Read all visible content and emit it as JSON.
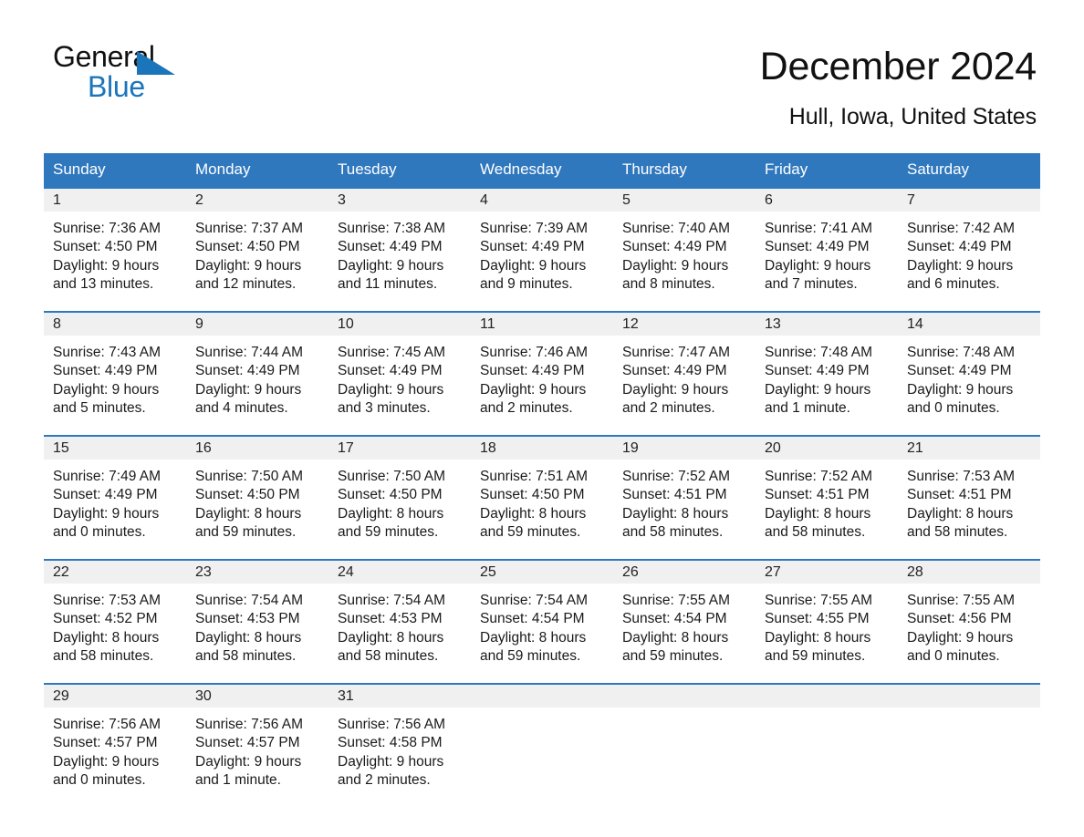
{
  "brand": {
    "name_part1": "General",
    "name_part2": "Blue",
    "accent_color": "#1b75bb"
  },
  "header": {
    "title": "December 2024",
    "location": "Hull, Iowa, United States"
  },
  "calendar": {
    "header_color": "#3078be",
    "daynum_band_color": "#f0f0f0",
    "weekday_headers": [
      "Sunday",
      "Monday",
      "Tuesday",
      "Wednesday",
      "Thursday",
      "Friday",
      "Saturday"
    ],
    "labels": {
      "sunrise_prefix": "Sunrise:",
      "sunset_prefix": "Sunset:",
      "daylight_prefix": "Daylight:"
    },
    "weeks": [
      [
        {
          "day": "1",
          "sunrise": "Sunrise: 7:36 AM",
          "sunset": "Sunset: 4:50 PM",
          "daylight_line1": "Daylight: 9 hours",
          "daylight_line2": "and 13 minutes."
        },
        {
          "day": "2",
          "sunrise": "Sunrise: 7:37 AM",
          "sunset": "Sunset: 4:50 PM",
          "daylight_line1": "Daylight: 9 hours",
          "daylight_line2": "and 12 minutes."
        },
        {
          "day": "3",
          "sunrise": "Sunrise: 7:38 AM",
          "sunset": "Sunset: 4:49 PM",
          "daylight_line1": "Daylight: 9 hours",
          "daylight_line2": "and 11 minutes."
        },
        {
          "day": "4",
          "sunrise": "Sunrise: 7:39 AM",
          "sunset": "Sunset: 4:49 PM",
          "daylight_line1": "Daylight: 9 hours",
          "daylight_line2": "and 9 minutes."
        },
        {
          "day": "5",
          "sunrise": "Sunrise: 7:40 AM",
          "sunset": "Sunset: 4:49 PM",
          "daylight_line1": "Daylight: 9 hours",
          "daylight_line2": "and 8 minutes."
        },
        {
          "day": "6",
          "sunrise": "Sunrise: 7:41 AM",
          "sunset": "Sunset: 4:49 PM",
          "daylight_line1": "Daylight: 9 hours",
          "daylight_line2": "and 7 minutes."
        },
        {
          "day": "7",
          "sunrise": "Sunrise: 7:42 AM",
          "sunset": "Sunset: 4:49 PM",
          "daylight_line1": "Daylight: 9 hours",
          "daylight_line2": "and 6 minutes."
        }
      ],
      [
        {
          "day": "8",
          "sunrise": "Sunrise: 7:43 AM",
          "sunset": "Sunset: 4:49 PM",
          "daylight_line1": "Daylight: 9 hours",
          "daylight_line2": "and 5 minutes."
        },
        {
          "day": "9",
          "sunrise": "Sunrise: 7:44 AM",
          "sunset": "Sunset: 4:49 PM",
          "daylight_line1": "Daylight: 9 hours",
          "daylight_line2": "and 4 minutes."
        },
        {
          "day": "10",
          "sunrise": "Sunrise: 7:45 AM",
          "sunset": "Sunset: 4:49 PM",
          "daylight_line1": "Daylight: 9 hours",
          "daylight_line2": "and 3 minutes."
        },
        {
          "day": "11",
          "sunrise": "Sunrise: 7:46 AM",
          "sunset": "Sunset: 4:49 PM",
          "daylight_line1": "Daylight: 9 hours",
          "daylight_line2": "and 2 minutes."
        },
        {
          "day": "12",
          "sunrise": "Sunrise: 7:47 AM",
          "sunset": "Sunset: 4:49 PM",
          "daylight_line1": "Daylight: 9 hours",
          "daylight_line2": "and 2 minutes."
        },
        {
          "day": "13",
          "sunrise": "Sunrise: 7:48 AM",
          "sunset": "Sunset: 4:49 PM",
          "daylight_line1": "Daylight: 9 hours",
          "daylight_line2": "and 1 minute."
        },
        {
          "day": "14",
          "sunrise": "Sunrise: 7:48 AM",
          "sunset": "Sunset: 4:49 PM",
          "daylight_line1": "Daylight: 9 hours",
          "daylight_line2": "and 0 minutes."
        }
      ],
      [
        {
          "day": "15",
          "sunrise": "Sunrise: 7:49 AM",
          "sunset": "Sunset: 4:49 PM",
          "daylight_line1": "Daylight: 9 hours",
          "daylight_line2": "and 0 minutes."
        },
        {
          "day": "16",
          "sunrise": "Sunrise: 7:50 AM",
          "sunset": "Sunset: 4:50 PM",
          "daylight_line1": "Daylight: 8 hours",
          "daylight_line2": "and 59 minutes."
        },
        {
          "day": "17",
          "sunrise": "Sunrise: 7:50 AM",
          "sunset": "Sunset: 4:50 PM",
          "daylight_line1": "Daylight: 8 hours",
          "daylight_line2": "and 59 minutes."
        },
        {
          "day": "18",
          "sunrise": "Sunrise: 7:51 AM",
          "sunset": "Sunset: 4:50 PM",
          "daylight_line1": "Daylight: 8 hours",
          "daylight_line2": "and 59 minutes."
        },
        {
          "day": "19",
          "sunrise": "Sunrise: 7:52 AM",
          "sunset": "Sunset: 4:51 PM",
          "daylight_line1": "Daylight: 8 hours",
          "daylight_line2": "and 58 minutes."
        },
        {
          "day": "20",
          "sunrise": "Sunrise: 7:52 AM",
          "sunset": "Sunset: 4:51 PM",
          "daylight_line1": "Daylight: 8 hours",
          "daylight_line2": "and 58 minutes."
        },
        {
          "day": "21",
          "sunrise": "Sunrise: 7:53 AM",
          "sunset": "Sunset: 4:51 PM",
          "daylight_line1": "Daylight: 8 hours",
          "daylight_line2": "and 58 minutes."
        }
      ],
      [
        {
          "day": "22",
          "sunrise": "Sunrise: 7:53 AM",
          "sunset": "Sunset: 4:52 PM",
          "daylight_line1": "Daylight: 8 hours",
          "daylight_line2": "and 58 minutes."
        },
        {
          "day": "23",
          "sunrise": "Sunrise: 7:54 AM",
          "sunset": "Sunset: 4:53 PM",
          "daylight_line1": "Daylight: 8 hours",
          "daylight_line2": "and 58 minutes."
        },
        {
          "day": "24",
          "sunrise": "Sunrise: 7:54 AM",
          "sunset": "Sunset: 4:53 PM",
          "daylight_line1": "Daylight: 8 hours",
          "daylight_line2": "and 58 minutes."
        },
        {
          "day": "25",
          "sunrise": "Sunrise: 7:54 AM",
          "sunset": "Sunset: 4:54 PM",
          "daylight_line1": "Daylight: 8 hours",
          "daylight_line2": "and 59 minutes."
        },
        {
          "day": "26",
          "sunrise": "Sunrise: 7:55 AM",
          "sunset": "Sunset: 4:54 PM",
          "daylight_line1": "Daylight: 8 hours",
          "daylight_line2": "and 59 minutes."
        },
        {
          "day": "27",
          "sunrise": "Sunrise: 7:55 AM",
          "sunset": "Sunset: 4:55 PM",
          "daylight_line1": "Daylight: 8 hours",
          "daylight_line2": "and 59 minutes."
        },
        {
          "day": "28",
          "sunrise": "Sunrise: 7:55 AM",
          "sunset": "Sunset: 4:56 PM",
          "daylight_line1": "Daylight: 9 hours",
          "daylight_line2": "and 0 minutes."
        }
      ],
      [
        {
          "day": "29",
          "sunrise": "Sunrise: 7:56 AM",
          "sunset": "Sunset: 4:57 PM",
          "daylight_line1": "Daylight: 9 hours",
          "daylight_line2": "and 0 minutes."
        },
        {
          "day": "30",
          "sunrise": "Sunrise: 7:56 AM",
          "sunset": "Sunset: 4:57 PM",
          "daylight_line1": "Daylight: 9 hours",
          "daylight_line2": "and 1 minute."
        },
        {
          "day": "31",
          "sunrise": "Sunrise: 7:56 AM",
          "sunset": "Sunset: 4:58 PM",
          "daylight_line1": "Daylight: 9 hours",
          "daylight_line2": "and 2 minutes."
        },
        {
          "day": "",
          "sunrise": "",
          "sunset": "",
          "daylight_line1": "",
          "daylight_line2": ""
        },
        {
          "day": "",
          "sunrise": "",
          "sunset": "",
          "daylight_line1": "",
          "daylight_line2": ""
        },
        {
          "day": "",
          "sunrise": "",
          "sunset": "",
          "daylight_line1": "",
          "daylight_line2": ""
        },
        {
          "day": "",
          "sunrise": "",
          "sunset": "",
          "daylight_line1": "",
          "daylight_line2": ""
        }
      ]
    ]
  }
}
